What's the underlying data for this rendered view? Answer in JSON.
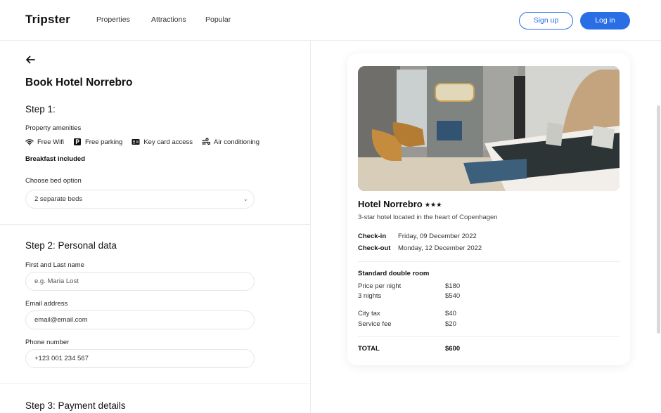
{
  "header": {
    "logo": "Tripster",
    "nav": [
      "Properties",
      "Attractions",
      "Popular"
    ],
    "signup": "Sign up",
    "login": "Log in",
    "accent_color": "#2a6ee6"
  },
  "booking": {
    "title": "Book Hotel Norrebro",
    "step1": {
      "title": "Step 1:",
      "amenities_label": "Property amenities",
      "amenities": [
        {
          "icon": "wifi-icon",
          "label": "Free Wifi"
        },
        {
          "icon": "parking-icon",
          "label": "Free parking"
        },
        {
          "icon": "key-card-icon",
          "label": "Key card access"
        },
        {
          "icon": "air-conditioning-icon",
          "label": "Air conditioning"
        }
      ],
      "breakfast": "Breakfast included",
      "bed_label": "Choose bed option",
      "bed_value": "2 separate beds"
    },
    "step2": {
      "title": "Step 2: Personal data",
      "name_label": "First and Last name",
      "name_placeholder": "e.g. Maria Lost",
      "email_label": "Email address",
      "email_value": "email@email.com",
      "phone_label": "Phone number",
      "phone_value": "+123 001 234 567"
    },
    "step3": {
      "title": "Step 3: Payment details"
    }
  },
  "summary": {
    "hotel_name": "Hotel Norrebro",
    "stars": "★★★",
    "subtitle": "3-star hotel located in the heart of Copenhagen",
    "checkin_label": "Check-in",
    "checkin_value": "Friday, 09 December 2022",
    "checkout_label": "Check-out",
    "checkout_value": "Monday, 12 December 2022",
    "room_type": "Standard double room",
    "price_label": "Price per night",
    "price_value": "$180",
    "nights_label": "3 nights",
    "nights_value": "$540",
    "tax_label": "City tax",
    "tax_value": "$40",
    "fee_label": "Service fee",
    "fee_value": "$20",
    "total_label": "TOTAL",
    "total_value": "$600"
  }
}
